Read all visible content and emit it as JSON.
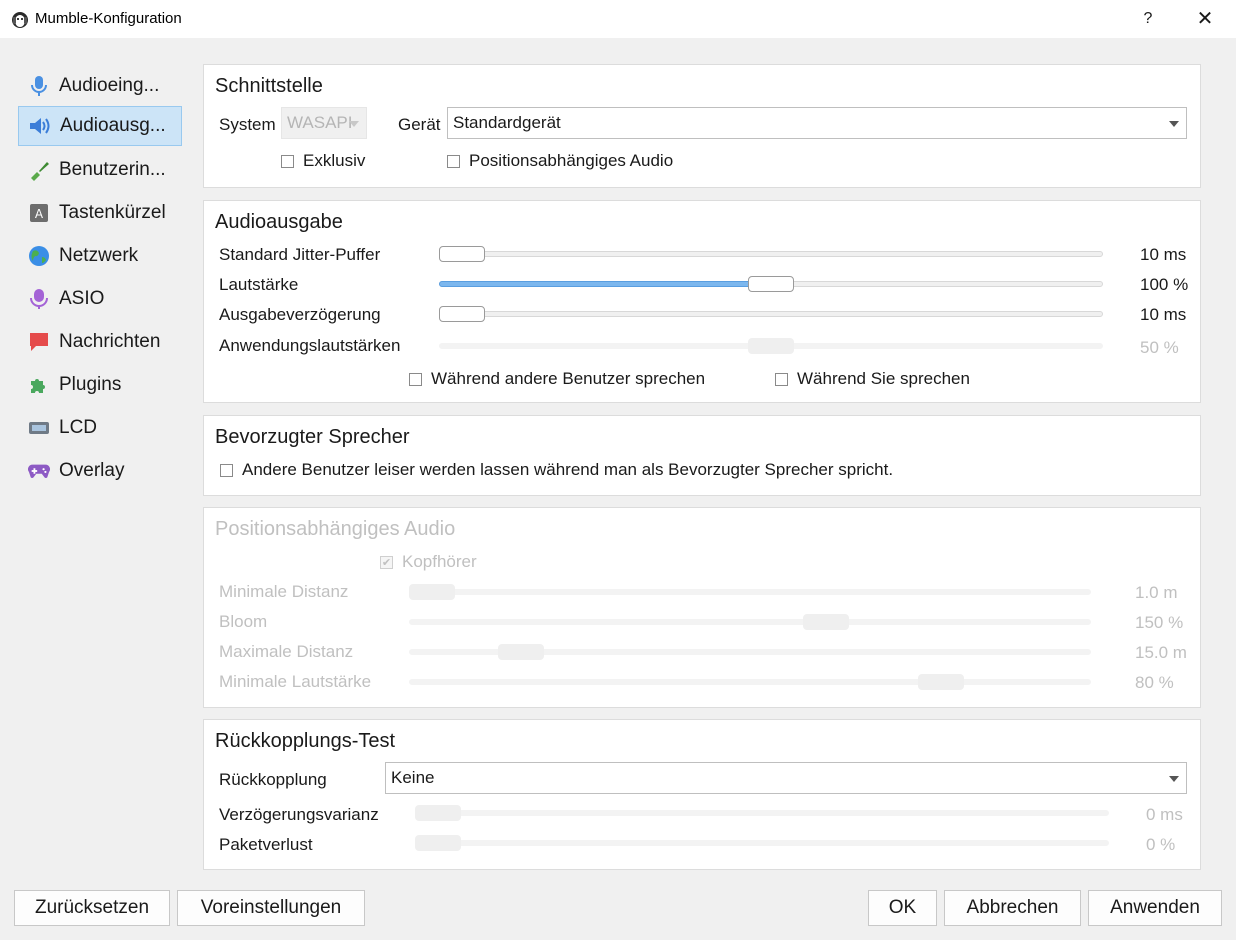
{
  "window": {
    "title": "Mumble-Konfiguration",
    "help": "?",
    "close": "✕"
  },
  "sidebar": {
    "items": [
      {
        "label": "Audioeing...",
        "icon": "microphone-icon"
      },
      {
        "label": "Audioausg...",
        "icon": "speaker-icon",
        "active": true
      },
      {
        "label": "Benutzerin...",
        "icon": "brush-icon"
      },
      {
        "label": "Tastenkürzel",
        "icon": "keyboard-key-icon"
      },
      {
        "label": "Netzwerk",
        "icon": "globe-icon"
      },
      {
        "label": "ASIO",
        "icon": "asio-microphone-icon"
      },
      {
        "label": "Nachrichten",
        "icon": "speech-bubble-icon"
      },
      {
        "label": "Plugins",
        "icon": "puzzle-icon"
      },
      {
        "label": "LCD",
        "icon": "lcd-icon"
      },
      {
        "label": "Overlay",
        "icon": "gamepad-icon"
      }
    ]
  },
  "interface": {
    "title": "Schnittstelle",
    "system_label": "System",
    "system_value": "WASAPI",
    "device_label": "Gerät",
    "device_value": "Standardgerät",
    "exclusive_label": "Exklusiv",
    "positional_label": "Positionsabhängiges Audio"
  },
  "audio_output": {
    "title": "Audioausgabe",
    "rows": [
      {
        "label": "Standard Jitter-Puffer",
        "value": "10 ms",
        "level": 0.0,
        "enabled": true
      },
      {
        "label": "Lautstärke",
        "value": "100 %",
        "level": 0.5,
        "enabled": true,
        "filled": true
      },
      {
        "label": "Ausgabeverzögerung",
        "value": "10 ms",
        "level": 0.0,
        "enabled": true
      },
      {
        "label": "Anwendungslautstärken",
        "value": "50 %",
        "level": 0.5,
        "enabled": false
      }
    ],
    "while_others_label": "Während andere Benutzer sprechen",
    "while_you_label": "Während Sie sprechen"
  },
  "priority_speaker": {
    "title": "Bevorzugter Sprecher",
    "checkbox_label": "Andere Benutzer leiser werden lassen während man als Bevorzugter Sprecher spricht."
  },
  "positional_audio": {
    "title": "Positionsabhängiges Audio",
    "headphones_label": "Kopfhörer",
    "rows": [
      {
        "label": "Minimale Distanz",
        "value": "1.0 m",
        "level": 0.0
      },
      {
        "label": "Bloom",
        "value": "150 %",
        "level": 0.62
      },
      {
        "label": "Maximale Distanz",
        "value": "15.0 m",
        "level": 0.14
      },
      {
        "label": "Minimale Lautstärke",
        "value": "80 %",
        "level": 0.8
      }
    ]
  },
  "loopback": {
    "title": "Rückkopplungs-Test",
    "mode_label": "Rückkopplung",
    "mode_value": "Keine",
    "rows": [
      {
        "label": "Verzögerungsvarianz",
        "value": "0 ms",
        "level": 0.0
      },
      {
        "label": "Paketverlust",
        "value": "0 %",
        "level": 0.0
      }
    ]
  },
  "buttons": {
    "reset": "Zurücksetzen",
    "defaults": "Voreinstellungen",
    "ok": "OK",
    "cancel": "Abbrechen",
    "apply": "Anwenden"
  }
}
